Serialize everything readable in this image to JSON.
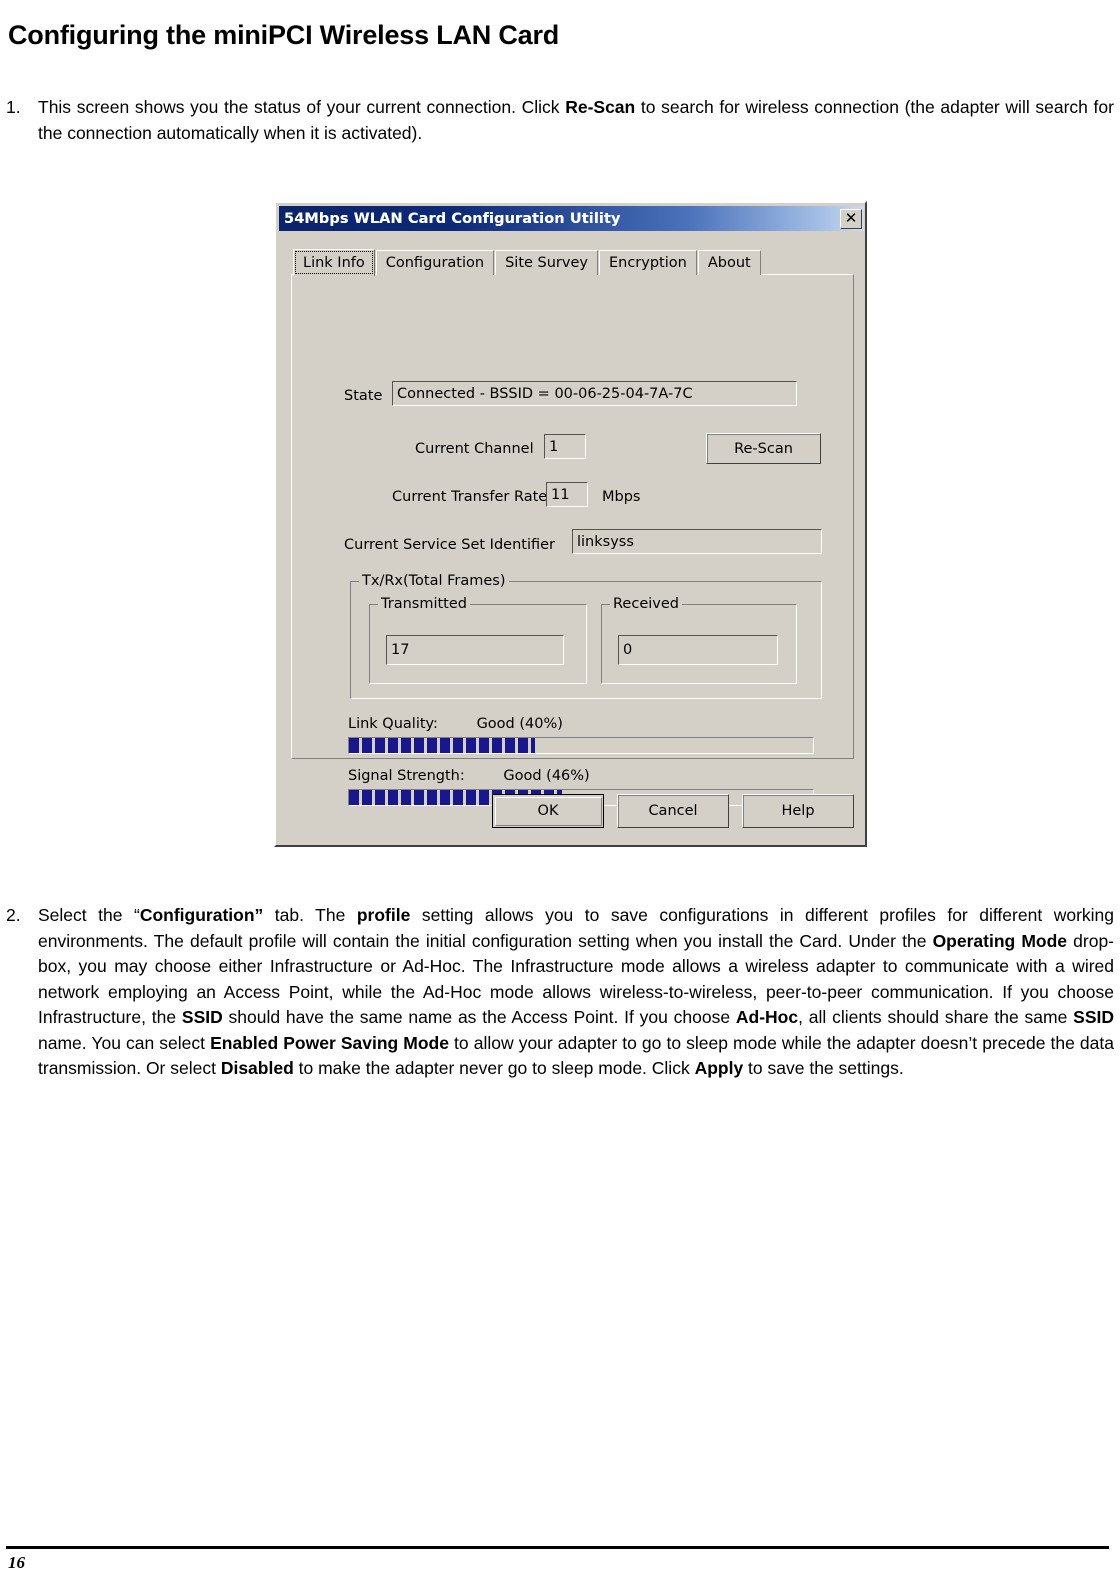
{
  "document": {
    "heading": "Configuring the miniPCI Wireless LAN Card",
    "page_number": "16",
    "steps": [
      {
        "number": "1.",
        "segments": [
          {
            "text": "This screen shows you the status of your current connection. Click ",
            "bold": false
          },
          {
            "text": "Re-Scan",
            "bold": true
          },
          {
            "text": " to search for wireless connection (the adapter will search for the connection automatically when it is activated).",
            "bold": false
          }
        ]
      },
      {
        "number": "2.",
        "segments": [
          {
            "text": "Select the “",
            "bold": false
          },
          {
            "text": "Configuration”",
            "bold": true
          },
          {
            "text": " tab. The ",
            "bold": false
          },
          {
            "text": "profile",
            "bold": true
          },
          {
            "text": " setting allows you to save configurations in different profiles for different working environments. The default profile will contain the initial configuration setting when you install the Card. Under the ",
            "bold": false
          },
          {
            "text": "Operating Mode",
            "bold": true
          },
          {
            "text": " drop-box, you may choose either Infrastructure or Ad-Hoc. The Infrastructure mode allows a wireless adapter to communicate with a wired network employing an Access Point, while the Ad-Hoc mode allows wireless-to-wireless, peer-to-peer communication. If you choose Infrastructure, the ",
            "bold": false
          },
          {
            "text": "SSID",
            "bold": true
          },
          {
            "text": " should have the same name as the Access Point. If you choose ",
            "bold": false
          },
          {
            "text": "Ad-Hoc",
            "bold": true
          },
          {
            "text": ", all clients should share the same ",
            "bold": false
          },
          {
            "text": "SSID",
            "bold": true
          },
          {
            "text": " name. You can select ",
            "bold": false
          },
          {
            "text": "Enabled Power Saving Mode",
            "bold": true
          },
          {
            "text": " to allow your adapter to go to sleep mode while the adapter doesn’t precede the data transmission. Or select ",
            "bold": false
          },
          {
            "text": "Disabled",
            "bold": true
          },
          {
            "text": " to make the adapter never go to sleep mode. Click ",
            "bold": false
          },
          {
            "text": "Apply",
            "bold": true
          },
          {
            "text": " to save the settings.",
            "bold": false
          }
        ]
      }
    ]
  },
  "dialog": {
    "title": "54Mbps WLAN Card Configuration Utility",
    "close_icon": "close-x-icon",
    "close_glyph": "✕",
    "tabs": [
      {
        "label": "Link Info",
        "active": true
      },
      {
        "label": "Configuration",
        "active": false
      },
      {
        "label": "Site Survey",
        "active": false
      },
      {
        "label": "Encryption",
        "active": false
      },
      {
        "label": "About",
        "active": false
      }
    ],
    "fields": {
      "state_label": "State",
      "state_value": "Connected - BSSID = 00-06-25-04-7A-7C",
      "channel_label": "Current Channel",
      "channel_value": "1",
      "rescan_label": "Re-Scan",
      "rate_label": "Current Transfer Rate",
      "rate_value": "11",
      "rate_unit": "Mbps",
      "ssid_label": "Current Service Set Identifier",
      "ssid_value": "linksyss"
    },
    "txrx_group": {
      "legend": "Tx/Rx(Total Frames)",
      "transmitted_legend": "Transmitted",
      "transmitted_value": "17",
      "received_legend": "Received",
      "received_value": "0"
    },
    "meters": {
      "link_quality_label": "Link Quality:",
      "link_quality_value": "Good (40%)",
      "link_quality_percent": 40,
      "signal_strength_label": "Signal Strength:",
      "signal_strength_value": "Good (46%)",
      "signal_strength_percent": 46,
      "fill_color": "#18188c"
    },
    "buttons": {
      "ok": "OK",
      "cancel": "Cancel",
      "help": "Help"
    },
    "colors": {
      "face": "#d4d0c8",
      "titlebar_start": "#0a246a",
      "titlebar_end": "#cddcf0",
      "meter_fill": "#18188c"
    }
  }
}
